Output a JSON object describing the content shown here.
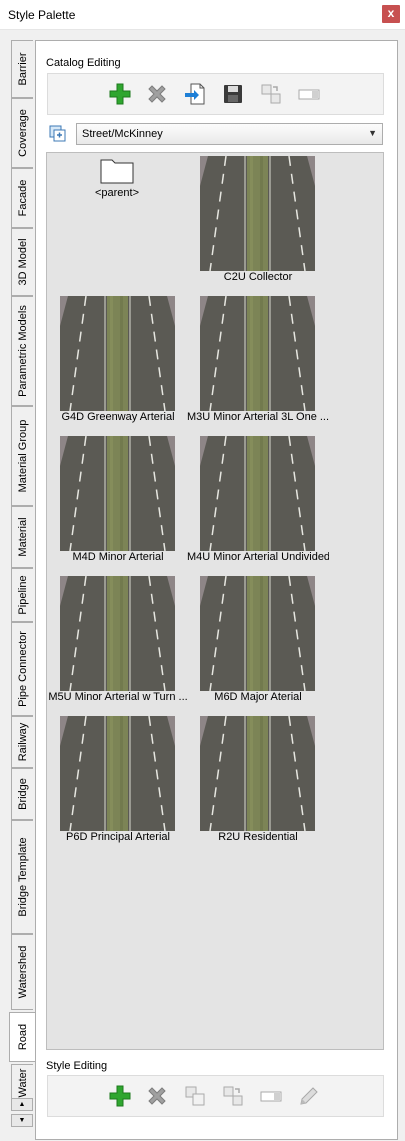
{
  "window": {
    "title": "Style Palette",
    "close_glyph": "x"
  },
  "tabs": [
    {
      "label": "Barrier",
      "active": false
    },
    {
      "label": "Coverage",
      "active": false
    },
    {
      "label": "Facade",
      "active": false
    },
    {
      "label": "3D Model",
      "active": false
    },
    {
      "label": "Parametric Models",
      "active": false
    },
    {
      "label": "Material Group",
      "active": false
    },
    {
      "label": "Material",
      "active": false
    },
    {
      "label": "Pipeline",
      "active": false
    },
    {
      "label": "Pipe Connector",
      "active": false
    },
    {
      "label": "Railway",
      "active": false
    },
    {
      "label": "Bridge",
      "active": false
    },
    {
      "label": "Bridge Template",
      "active": false
    },
    {
      "label": "Watershed",
      "active": false
    },
    {
      "label": "Road",
      "active": true
    },
    {
      "label": "Water",
      "active": false
    }
  ],
  "tab_scroll": {
    "up_glyph": "▲",
    "down_glyph": "▼"
  },
  "catalog_editing": {
    "label": "Catalog Editing",
    "tools": [
      "add-icon",
      "delete-icon",
      "import-icon",
      "save-icon",
      "copy-styles-icon",
      "rename-icon"
    ]
  },
  "catalog_selector": {
    "value": "Street/McKinney",
    "arrow_glyph": "▼"
  },
  "catalog": {
    "parent_label": "<parent>",
    "items": [
      "C2U Collector",
      "G4D Greenway Arterial",
      "M3U Minor Arterial 3L One ...",
      "M4D Minor Arterial",
      "M4U Minor Arterial Undivided",
      "M5U Minor Arterial w Turn ...",
      "M6D Major Aterial",
      "P6D Principal Arterial",
      "R2U Residential"
    ]
  },
  "style_editing": {
    "label": "Style Editing",
    "tools": [
      "add-icon",
      "delete-icon",
      "duplicate-icon",
      "copy-icon",
      "rename-icon",
      "edit-icon"
    ]
  },
  "colors": {
    "add": "#2fa62f",
    "delete": "#9b9b9b",
    "asphalt": "#5b5a54",
    "median": "#7c8456",
    "sidewalk": "#8e8687"
  }
}
